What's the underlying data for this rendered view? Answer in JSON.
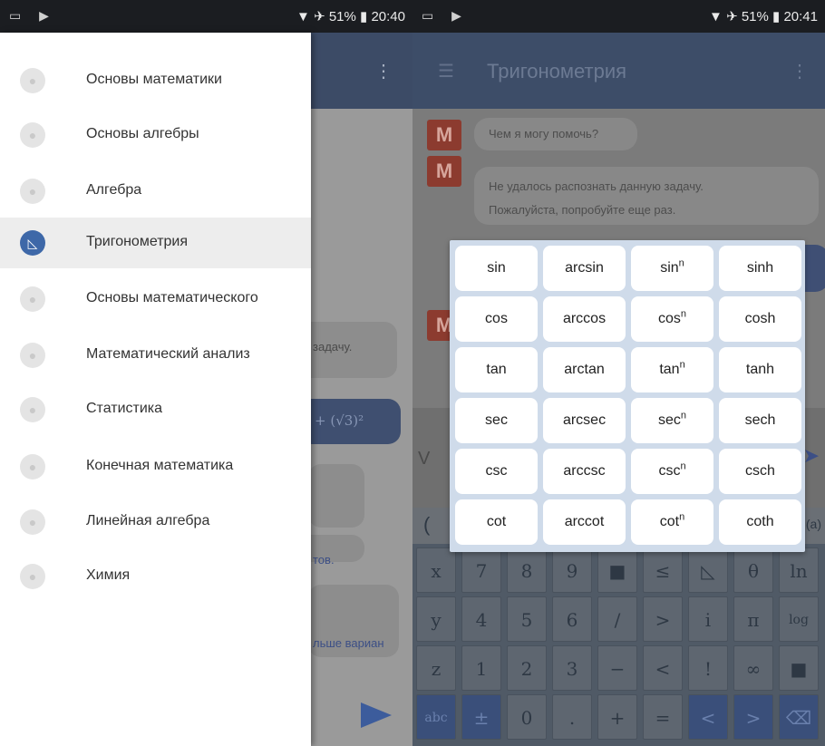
{
  "left": {
    "status": {
      "battery": "51%",
      "time": "20:40"
    },
    "drawer_items": [
      {
        "label": "Основы математики",
        "selected": false
      },
      {
        "label": "Основы алгебры",
        "selected": false
      },
      {
        "label": "Алгебра",
        "selected": false
      },
      {
        "label": "Тригонометрия",
        "selected": true
      },
      {
        "label": "Основы математического",
        "selected": false
      },
      {
        "label": "Математический анализ",
        "selected": false
      },
      {
        "label": "Статистика",
        "selected": false
      },
      {
        "label": "Конечная математика",
        "selected": false
      },
      {
        "label": "Линейная алгебра",
        "selected": false
      },
      {
        "label": "Химия",
        "selected": false
      }
    ],
    "background_fragments": {
      "zadachu": "задачу.",
      "formula": "+ (√3)²",
      "tov": "тов.",
      "bolshe": "льше вариан"
    }
  },
  "right": {
    "status": {
      "battery": "51%",
      "time": "20:41"
    },
    "title": "Тригонометрия",
    "messages": [
      {
        "text": "Чем я могу помочь?"
      },
      {
        "text_line1": "Не удалось распознать данную задачу.",
        "text_line2": "Пожалуйста, попробуйте еще раз."
      }
    ],
    "avatar_letter": "M",
    "input_fragment": "V",
    "trig_keys": [
      [
        "sin",
        "arcsin",
        "sin",
        "sinh"
      ],
      [
        "cos",
        "arccos",
        "cos",
        "cosh"
      ],
      [
        "tan",
        "arctan",
        "tan",
        "tanh"
      ],
      [
        "sec",
        "arcsec",
        "sec",
        "sech"
      ],
      [
        "csc",
        "arccsc",
        "csc",
        "csch"
      ],
      [
        "cot",
        "arccot",
        "cot",
        "coth"
      ]
    ],
    "power_sup": "n",
    "keyboard_rows": [
      [
        "x",
        "7",
        "8",
        "9",
        "■",
        "≤",
        "◺",
        "θ",
        "ln"
      ],
      [
        "y",
        "4",
        "5",
        "6",
        "/",
        ">",
        "i",
        "π",
        "log"
      ],
      [
        "z",
        "1",
        "2",
        "3",
        "−",
        "<",
        "!",
        "∞",
        "■"
      ],
      [
        "abc",
        "±",
        "0",
        ".",
        "+",
        "=",
        "<",
        ">",
        "⌫"
      ]
    ],
    "keyboard_top": {
      "left": "(",
      "right": "(a)"
    }
  }
}
